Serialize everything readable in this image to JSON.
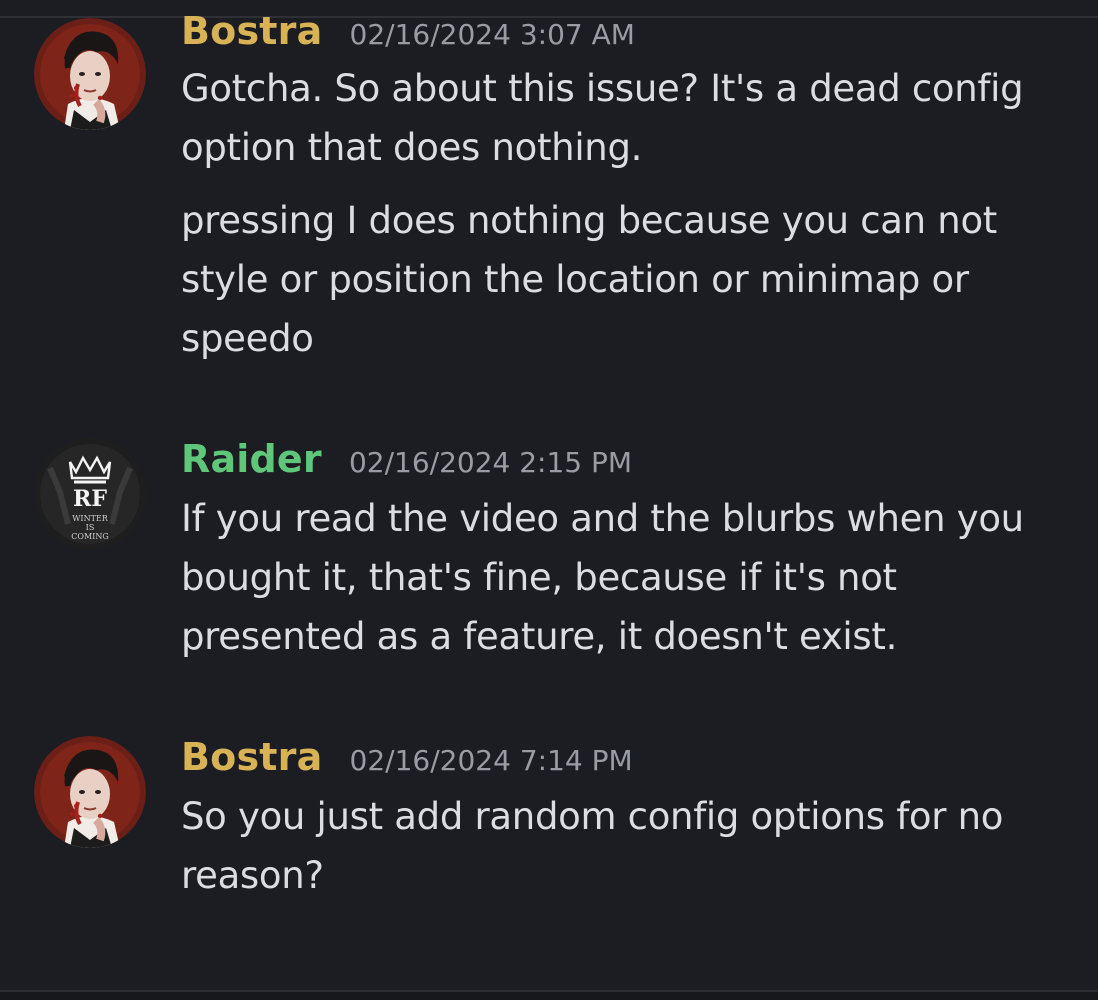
{
  "colors": {
    "background": "#1c1d22",
    "text": "#dcdde1",
    "timestamp": "#9a9ca4",
    "bostra_name": "#d8b356",
    "raider_name": "#5ec77a"
  },
  "messages": [
    {
      "author": "Bostra",
      "avatar_icon": "bostra-avatar-portrait",
      "timestamp": "02/16/2024 3:07 AM",
      "paragraphs": [
        "Gotcha. So about this issue? It's a dead config option that does nothing.",
        "pressing I does nothing because you can not style or position the location or minimap or speedo"
      ]
    },
    {
      "author": "Raider",
      "avatar_icon": "raider-crown-logo-avatar",
      "avatar_text": [
        "WINTER",
        "IS",
        "COMING"
      ],
      "timestamp": "02/16/2024 2:15 PM",
      "paragraphs": [
        "If you read the video and the blurbs when you bought it, that's fine, because if it's not presented as a feature, it doesn't exist."
      ]
    },
    {
      "author": "Bostra",
      "avatar_icon": "bostra-avatar-portrait",
      "timestamp": "02/16/2024 7:14 PM",
      "paragraphs": [
        "So you just add random config options for no reason?"
      ]
    }
  ]
}
